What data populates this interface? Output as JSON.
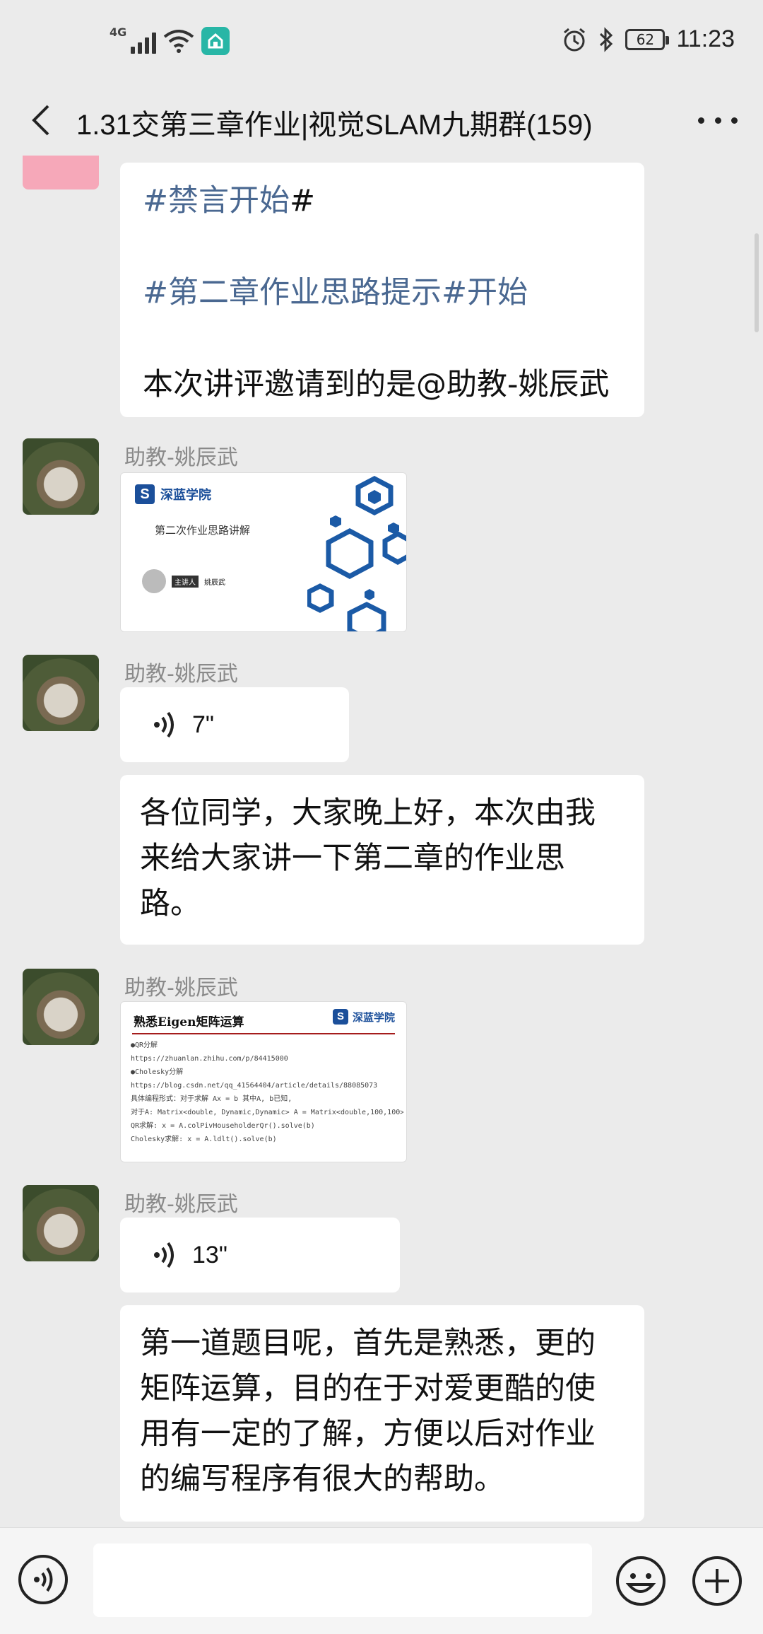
{
  "status_bar": {
    "network": "4G",
    "battery": "62",
    "time": "11:23"
  },
  "header": {
    "title": "1.31交第三章作业|视觉SLAM九期群(159)"
  },
  "messages": {
    "system_msg": {
      "line1_tag": "#禁言开始",
      "line1_hash": "#",
      "line2": "#第二章作业思路提示#开始",
      "line3": "本次讲评邀请到的是@助教-姚辰武"
    },
    "sender_name": "助教-姚辰武",
    "slide_image": {
      "brand": "深蓝学院",
      "title": "第二次作业思路讲解",
      "presenter_tag": "主讲人",
      "presenter": "姚辰武"
    },
    "voice1": {
      "duration": "7\""
    },
    "text1": "各位同学，大家晚上好，本次由我来给大家讲一下第二章的作业思路。",
    "doc_image": {
      "heading": "熟悉Eigen矩阵运算",
      "brand": "深蓝学院",
      "lines": [
        "●QR分解",
        "https://zhuanlan.zhihu.com/p/84415000",
        "●Cholesky分解",
        "https://blog.csdn.net/qq_41564404/article/details/88085073",
        "具体编程形式：对于求解 Ax = b 其中A, b已知,",
        "对于A: Matrix<double, Dynamic,Dynamic> A = Matrix<double,100,100>::Random()",
        "QR求解: x = A.colPivHouseholderQr().solve(b)",
        "Cholesky求解: x = A.ldlt().solve(b)"
      ]
    },
    "voice2": {
      "duration": "13\""
    },
    "text2": "第一道题目呢，首先是熟悉，更的矩阵运算，目的在于对爱更酷的使用有一定的了解，方便以后对作业的编写程序有很大的帮助。"
  },
  "colors": {
    "background": "#ebebeb",
    "tag_blue": "#4a6891",
    "hotspot": "#28b6a6",
    "brand_blue": "#1b4f9a"
  }
}
